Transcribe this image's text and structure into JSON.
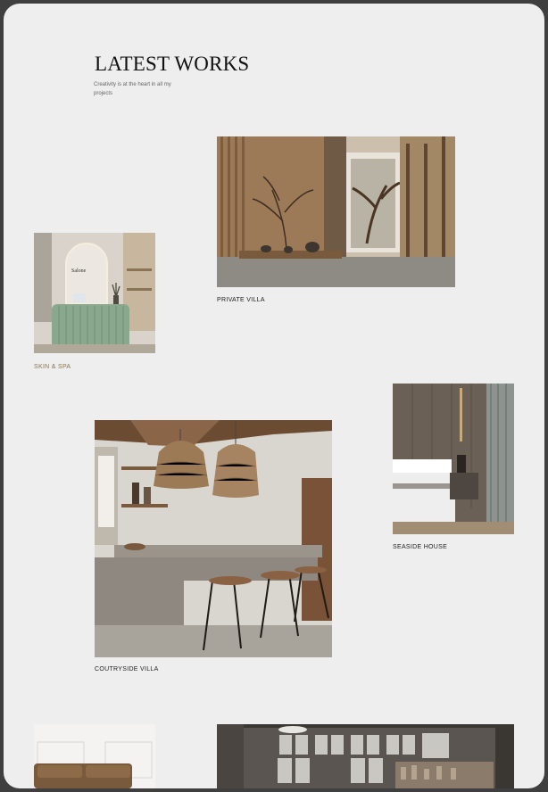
{
  "header": {
    "title": "LATEST WORKS",
    "subtitle": "Creativity is at the heart in all my projects"
  },
  "works": [
    {
      "caption": "PRIVATE VILLA",
      "image": "private-villa-interior"
    },
    {
      "caption": "SKIN & SPA",
      "image": "spa-reception-desk",
      "label_in_image": "Salone"
    },
    {
      "caption": "SEASIDE HOUSE",
      "image": "bedroom-interior"
    },
    {
      "caption": "COUTRYSIDE VILLA",
      "image": "kitchen-island-interior"
    },
    {
      "caption": "",
      "image": "living-room-sofa"
    },
    {
      "caption": "",
      "image": "industrial-loft-interior"
    }
  ],
  "colors": {
    "frame": "#3f3f3f",
    "background": "#eeeeee",
    "accent_caption": "#8a7450"
  }
}
